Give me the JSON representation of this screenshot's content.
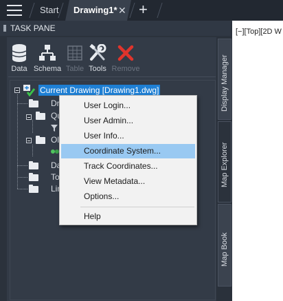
{
  "tabs": {
    "start_label": "Start",
    "drawing_label": "Drawing1*",
    "close_glyph": "✕",
    "add_glyph": "+"
  },
  "task_pane": {
    "title": "TASK PANE",
    "toolbar": [
      {
        "label": "Data",
        "icon": "database-icon",
        "enabled": true
      },
      {
        "label": "Schema",
        "icon": "schema-icon",
        "enabled": true
      },
      {
        "label": "Table",
        "icon": "table-icon",
        "enabled": false
      },
      {
        "label": "Tools",
        "icon": "tools-icon",
        "enabled": true
      },
      {
        "label": "Remove",
        "icon": "remove-x-icon",
        "enabled": false
      }
    ]
  },
  "tree": {
    "root_label": "Current Drawing [Drawing1.dwg]",
    "children": [
      {
        "label": "Dr"
      },
      {
        "label": "Qu"
      },
      {
        "label": "Ol"
      },
      {
        "label": "Da"
      },
      {
        "label": "To"
      },
      {
        "label": "Lin"
      }
    ]
  },
  "context_menu": {
    "items": [
      {
        "label": "User Login..."
      },
      {
        "label": "User Admin..."
      },
      {
        "label": "User Info..."
      },
      {
        "label": "Coordinate System...",
        "highlighted": true
      },
      {
        "label": "Track Coordinates..."
      },
      {
        "label": "View Metadata..."
      },
      {
        "label": "Options..."
      },
      {
        "label": "Help"
      }
    ]
  },
  "side_tabs": {
    "display_manager": "Display Manager",
    "map_explorer": "Map Explorer",
    "map_book": "Map Book"
  },
  "viewport": {
    "label": "[−][Top][2D W"
  },
  "colors": {
    "background": "#2b323c",
    "selection": "#1e7fd4",
    "menu_highlight": "#99c9f2",
    "remove_red": "#e0342c"
  }
}
